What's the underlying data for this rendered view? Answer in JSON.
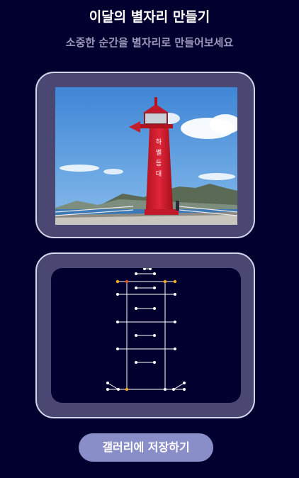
{
  "header": {
    "title": "이달의 별자리 만들기",
    "subtitle": "소중한 순간을 별자리로 만들어보세요"
  },
  "photo": {
    "subject": "red lighthouse by the sea",
    "sign_text": "하멜등대"
  },
  "constellation": {
    "star_color": "#ffffff",
    "highlight_color": "#f7a81b",
    "accent_color": "#d9521a"
  },
  "actions": {
    "save_label": "갤러리에 저장하기"
  },
  "colors": {
    "background": "#02002e",
    "card": "#4a4873",
    "button": "#8a8ec8"
  }
}
